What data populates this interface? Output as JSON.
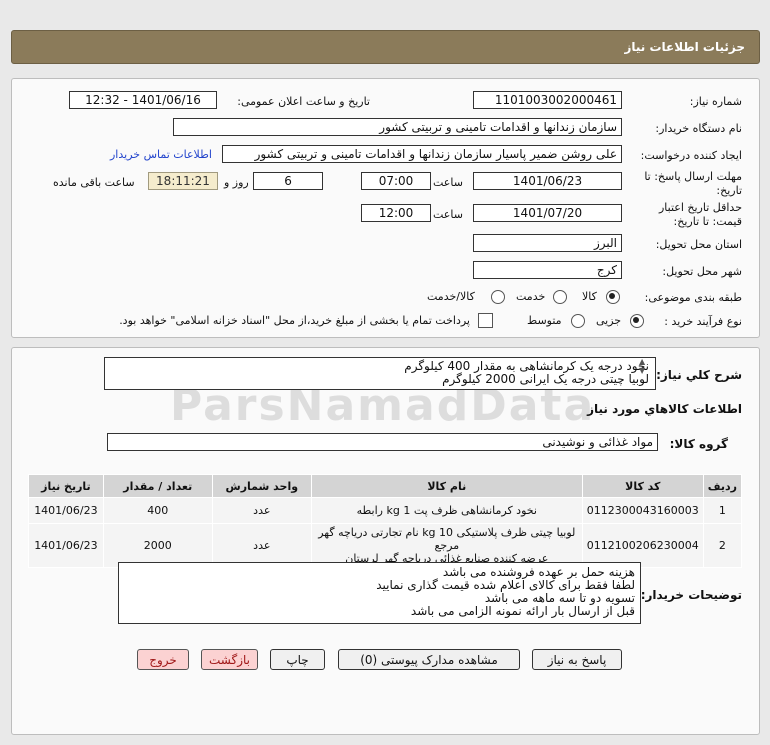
{
  "page_title": "جزئیات اطلاعات نیاز",
  "need_number": {
    "label": "شماره نیاز:",
    "value": "1101003002000461"
  },
  "announce": {
    "label": "تاریخ و ساعت اعلان عمومی:",
    "value": "1401/06/16 - 12:32"
  },
  "buyer_org": {
    "label": "نام دستگاه خریدار:",
    "value": "سازمان زندانها و اقدامات تامینی و تربیتی کشور"
  },
  "creator": {
    "label": "ایجاد کننده درخواست:",
    "value": "علی روشن ضمیر پاسیار سازمان زندانها و اقدامات تامینی و تربیتی کشور",
    "contact_link": "اطلاعات تماس خریدار"
  },
  "deadline": {
    "label_line1": "مهلت ارسال پاسخ: تا",
    "label_line2": "تاریخ:",
    "date": "1401/06/23",
    "time_label": "ساعت",
    "time": "07:00",
    "days": "6",
    "days_label": "روز و",
    "remaining": "18:11:21",
    "remaining_label": "ساعت باقی مانده"
  },
  "validity": {
    "label_line1": "حداقل تاریخ اعتبار",
    "label_line2": "قیمت: تا تاریخ:",
    "date": "1401/07/20",
    "time_label": "ساعت",
    "time": "12:00"
  },
  "province": {
    "label": "استان محل تحویل:",
    "value": "البرز"
  },
  "city": {
    "label": "شهر محل تحویل:",
    "value": "کرج"
  },
  "category": {
    "label": "طبقه بندی موضوعی:",
    "options": [
      "کالا",
      "خدمت",
      "کالا/خدمت"
    ],
    "selected": "کالا"
  },
  "process": {
    "label": "نوع فرآیند خرید :",
    "options": [
      "جزیی",
      "متوسط"
    ],
    "selected": "جزیی",
    "payment_note": "پرداخت تمام یا بخشی از مبلغ خرید،از محل \"اسناد خزانه اسلامی\" خواهد بود."
  },
  "summary": {
    "label": "شرح کلي نياز:",
    "line1": "نخود درجه یک کرمانشاهی به مقدار 400 کیلوگرم",
    "line2": "لوبیا چیتی درجه یک ایرانی 2000 کیلوگرم"
  },
  "goods_info_title": "اطلاعات کالاهاي مورد نياز",
  "goods_group": {
    "label": "گروه کالا:",
    "value": "مواد غذائی و نوشیدنی"
  },
  "table": {
    "headers": [
      "ردیف",
      "کد کالا",
      "نام کالا",
      "واحد شمارش",
      "تعداد / مقدار",
      "تاریخ نیاز"
    ],
    "rows": [
      {
        "row": "1",
        "code": "0112300043160003",
        "name_l1": "نخود کرمانشاهی ظرف پت 1 kg رابطه",
        "name_l2": "",
        "unit": "عدد",
        "qty": "400",
        "date": "1401/06/23"
      },
      {
        "row": "2",
        "code": "0112100206230004",
        "name_l1": "لوبیا چیتی ظرف پلاستیکی 10 kg نام تجارتی دریاچه گهر مرجع",
        "name_l2": "عرضه کننده صنایع غذائی دریاچه گهر لرستان",
        "unit": "عدد",
        "qty": "2000",
        "date": "1401/06/23"
      }
    ]
  },
  "buyer_notes": {
    "label": "توضیحات خریدار:",
    "lines": [
      "هزینه حمل بر عهده فروشنده می باشد",
      "لطفا فقط برای کالای اعلام شده قیمت گذاری نمایید",
      "تسویه دو تا سه ماهه می باشد",
      "قبل از ارسال بار ارائه نمونه الزامی می باشد"
    ]
  },
  "buttons": {
    "reply": "پاسخ به نیاز",
    "attachments": "مشاهده مدارک پیوستی (0)",
    "print": "چاپ",
    "back": "بازگشت",
    "exit": "خروج"
  },
  "watermark": "ParsNamadData"
}
